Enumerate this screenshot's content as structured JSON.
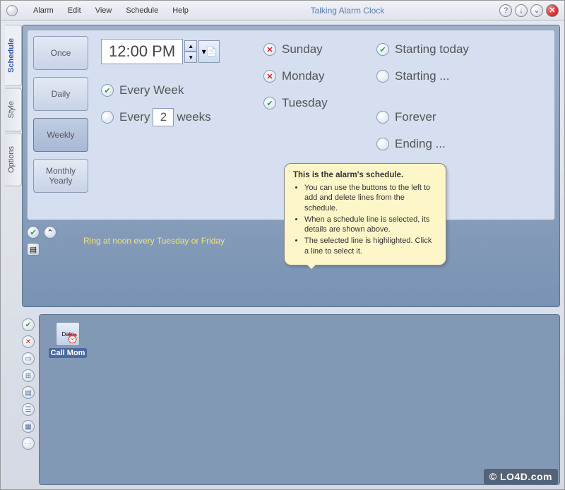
{
  "app": {
    "title": "Talking Alarm Clock",
    "menu": [
      "Alarm",
      "Edit",
      "View",
      "Schedule",
      "Help"
    ]
  },
  "titlebar_buttons": {
    "help": "?",
    "down": "↓",
    "min": "⌄",
    "close": "✕"
  },
  "side_tabs": [
    "Schedule",
    "Style",
    "Options"
  ],
  "freq_buttons": {
    "once": "Once",
    "daily": "Daily",
    "weekly": "Weekly",
    "monthly_yearly": "Monthly\nYearly"
  },
  "time_value": "12:00 PM",
  "weekly": {
    "every_week_label": "Every Week",
    "every_n_prefix": "Every",
    "every_n_value": "2",
    "every_n_suffix": "weeks"
  },
  "days": {
    "sunday": "Sunday",
    "monday": "Monday",
    "tuesday": "Tuesday"
  },
  "range": {
    "starting_today": "Starting today",
    "starting": "Starting ...",
    "forever": "Forever",
    "ending": "Ending ..."
  },
  "summary": "Ring at noon every Tuesday or Friday",
  "alarm_item": {
    "label": "Call Mom",
    "icon_text": "Date"
  },
  "tooltip": {
    "title": "This is the alarm's schedule.",
    "bullets": [
      "You can use the buttons to the left to add and delete lines from the schedule.",
      "When a schedule line is selected, its details are shown above.",
      "The selected line is highlighted. Click a line to select it."
    ]
  },
  "watermark": "© LO4D.com"
}
